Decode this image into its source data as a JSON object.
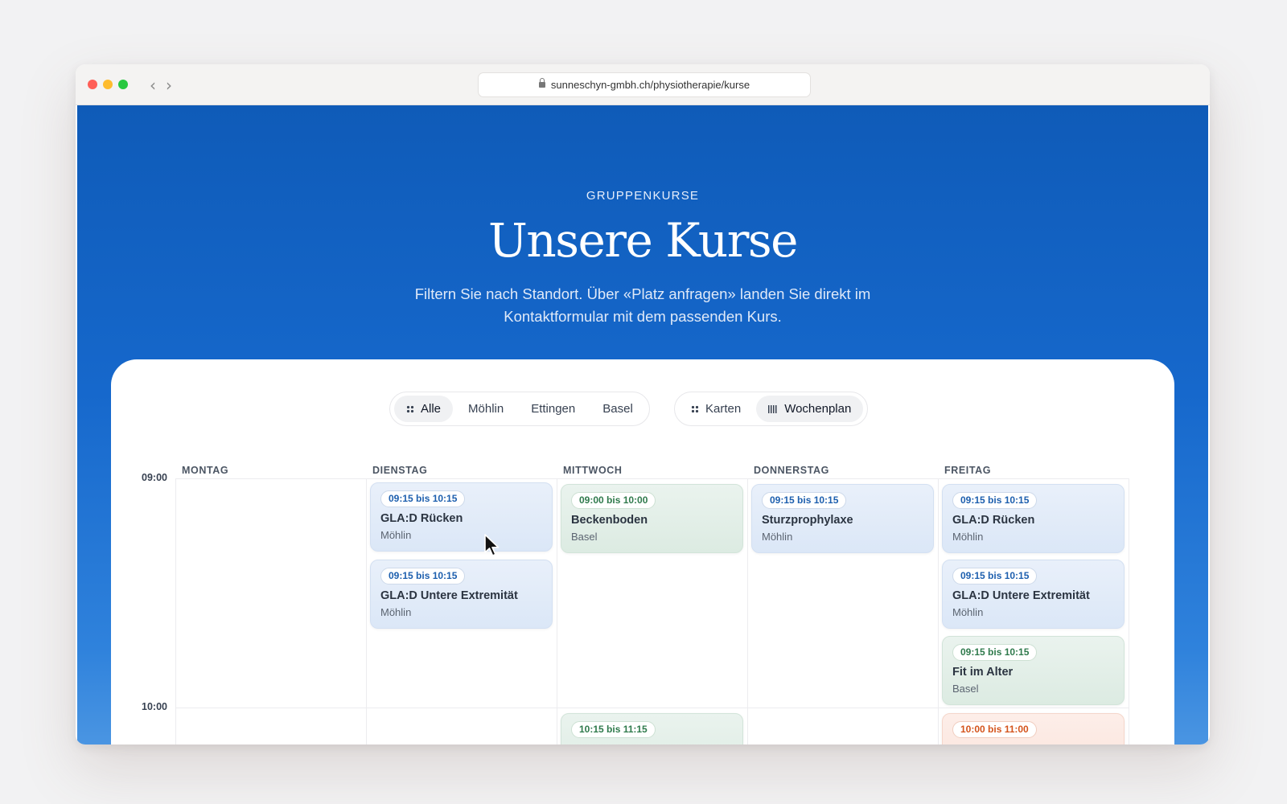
{
  "browser": {
    "url": "sunneschyn-gmbh.ch/physiotherapie/kurse",
    "back_glyph": "‹",
    "forward_glyph": "›"
  },
  "hero": {
    "eyebrow": "GRUPPENKURSE",
    "title": "Unsere Kurse",
    "subtitle": "Filtern Sie nach Standort. Über «Platz anfragen» landen Sie direkt im Kontaktformular mit dem passenden Kurs."
  },
  "location_filter": [
    {
      "label": "Alle",
      "active": true
    },
    {
      "label": "Möhlin",
      "active": false
    },
    {
      "label": "Ettingen",
      "active": false
    },
    {
      "label": "Basel",
      "active": false
    }
  ],
  "view_toggle": [
    {
      "label": "Karten",
      "active": false
    },
    {
      "label": "Wochenplan",
      "active": true
    }
  ],
  "times": [
    "09:00",
    "10:00"
  ],
  "days": [
    "MONTAG",
    "DIENSTAG",
    "MITTWOCH",
    "DONNERSTAG",
    "FREITAG"
  ],
  "events": {
    "dienstag": [
      {
        "time": "09:15 bis 10:15",
        "title": "GLA:D Rücken",
        "location": "Möhlin"
      },
      {
        "time": "09:15 bis 10:15",
        "title": "GLA:D Untere Extremität",
        "location": "Möhlin"
      }
    ],
    "mittwoch": [
      {
        "time": "09:00 bis 10:00",
        "title": "Beckenboden",
        "location": "Basel"
      },
      {
        "time": "10:15 bis 11:15"
      }
    ],
    "donnerstag": [
      {
        "time": "09:15 bis 10:15",
        "title": "Sturzprophylaxe",
        "location": "Möhlin"
      }
    ],
    "freitag": [
      {
        "time": "09:15 bis 10:15",
        "title": "GLA:D Rücken",
        "location": "Möhlin"
      },
      {
        "time": "09:15 bis 10:15",
        "title": "GLA:D Untere Extremität",
        "location": "Möhlin"
      },
      {
        "time": "09:15 bis 10:15",
        "title": "Fit im Alter",
        "location": "Basel"
      },
      {
        "time": "10:00 bis 11:00"
      }
    ]
  },
  "colors": {
    "hero_blue": "#1668cc",
    "event_blue": "#dbe7f7",
    "event_green": "#dcebe2",
    "event_orange": "#fae2d9"
  }
}
